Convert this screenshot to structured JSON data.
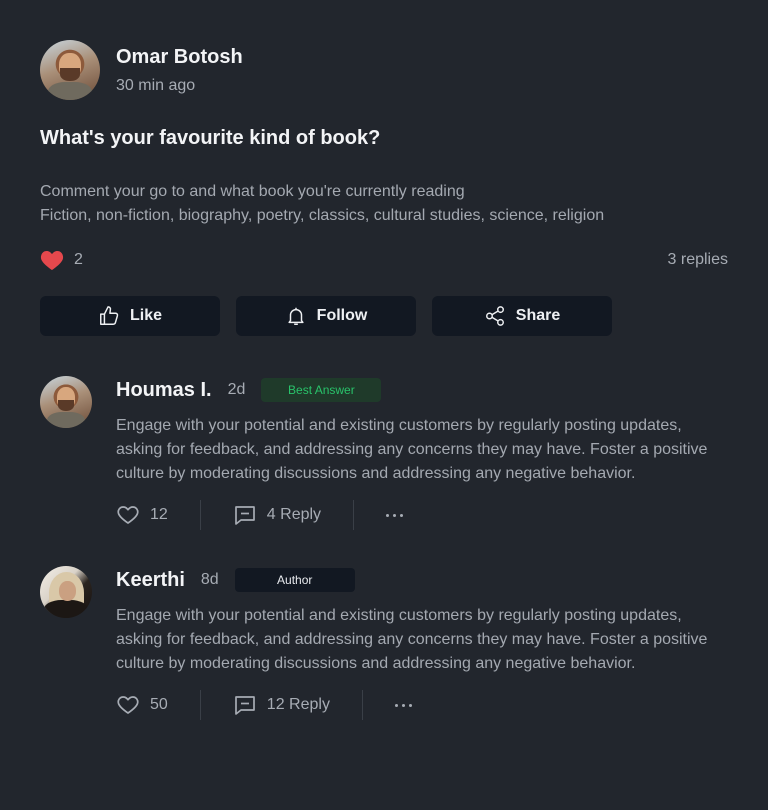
{
  "post": {
    "author": "Omar Botosh",
    "time": "30 min ago",
    "title": "What's your favourite kind of book?",
    "body_lines": [
      "Comment your go to and what book you're currently reading",
      "Fiction, non-fiction, biography, poetry, classics, cultural studies, science, religion"
    ],
    "likes": "2",
    "replies": "3 replies",
    "heart_color": "#e5484d"
  },
  "actions": {
    "like": "Like",
    "follow": "Follow",
    "share": "Share"
  },
  "comments": [
    {
      "name": "Houmas I.",
      "time": "2d",
      "badge": "Best Answer",
      "text": "Engage with your potential and existing customers by regularly posting updates, asking for feedback, and addressing any concerns they may have. Foster a positive culture by moderating discussions and addressing any negative behavior.",
      "likes": "12",
      "reply": "4 Reply"
    },
    {
      "name": "Keerthi",
      "time": "8d",
      "badge": "Author",
      "text": "Engage with your potential and existing customers by regularly posting updates, asking for feedback, and addressing any concerns they may have. Foster a positive culture by moderating discussions and addressing any negative behavior.",
      "likes": "50",
      "reply": "12 Reply"
    }
  ],
  "colors": {
    "background": "#22262d",
    "button_bg": "#121822",
    "best_answer_text": "#29c26a",
    "best_answer_bg": "#1f3a2a"
  }
}
